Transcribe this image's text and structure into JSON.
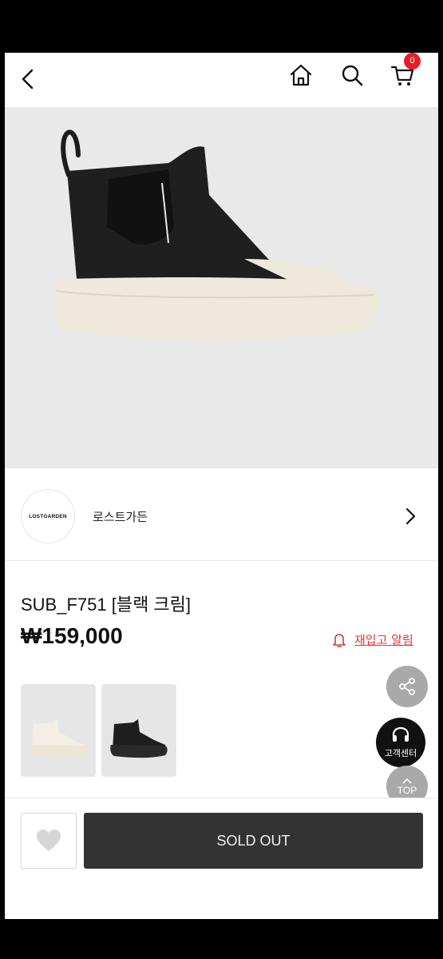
{
  "header": {
    "cart_count": "0"
  },
  "brand": {
    "logo_text": "LOSTGARDEN",
    "name": "로스트가든"
  },
  "product": {
    "title": "SUB_F751 [블랙 크림]",
    "price": "₩159,000",
    "restock_label": "재입고 알림"
  },
  "floating": {
    "customer_center_label": "고객센터",
    "top_label": "TOP"
  },
  "actions": {
    "soldout_label": "SOLD OUT"
  },
  "colors": {
    "accent_red": "#e21f26",
    "soldout_bg": "#333333",
    "restock_red": "#d9383a"
  }
}
